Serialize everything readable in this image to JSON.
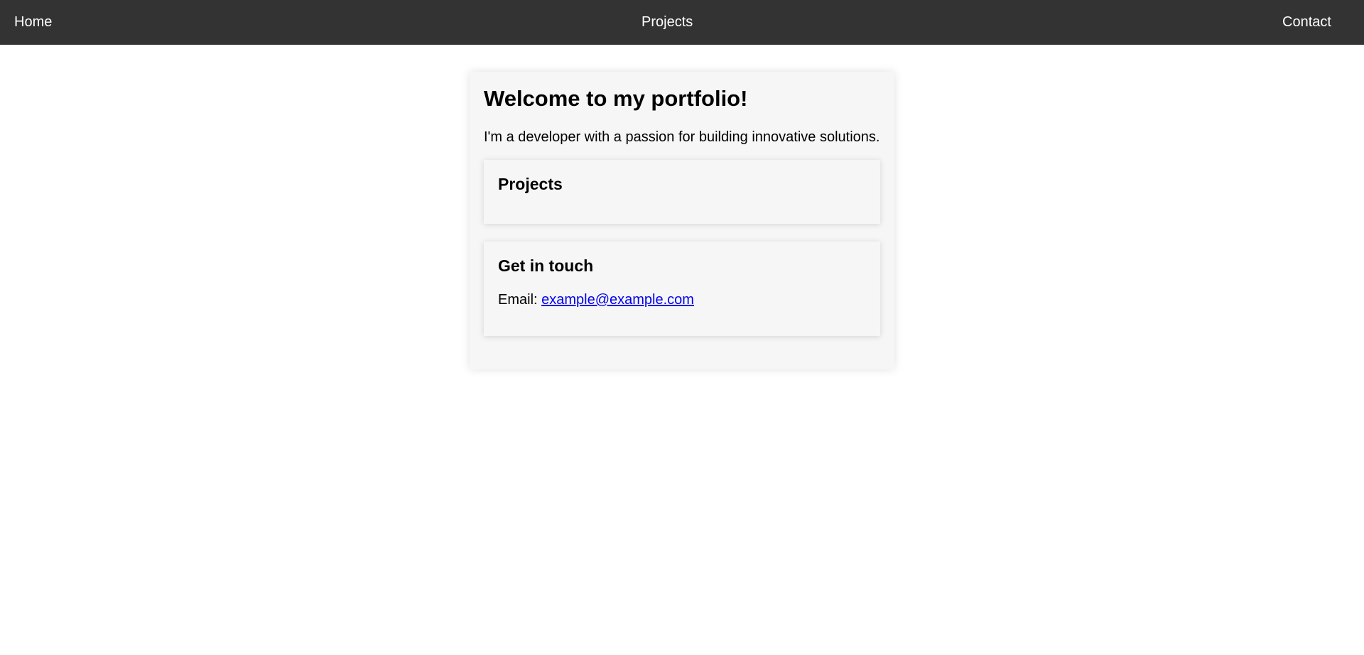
{
  "nav": {
    "home_label": "Home",
    "projects_label": "Projects",
    "contact_label": "Contact"
  },
  "main": {
    "title": "Welcome to my portfolio!",
    "intro": "I'm a developer with a passion for building innovative solutions.",
    "projects": {
      "title": "Projects"
    },
    "contact": {
      "title": "Get in touch",
      "email_label": "Email: ",
      "email": "example@example.com"
    }
  },
  "colors": {
    "navbar_background": "#333333",
    "card_background": "#f6f6f6",
    "link": "#0000ee"
  }
}
